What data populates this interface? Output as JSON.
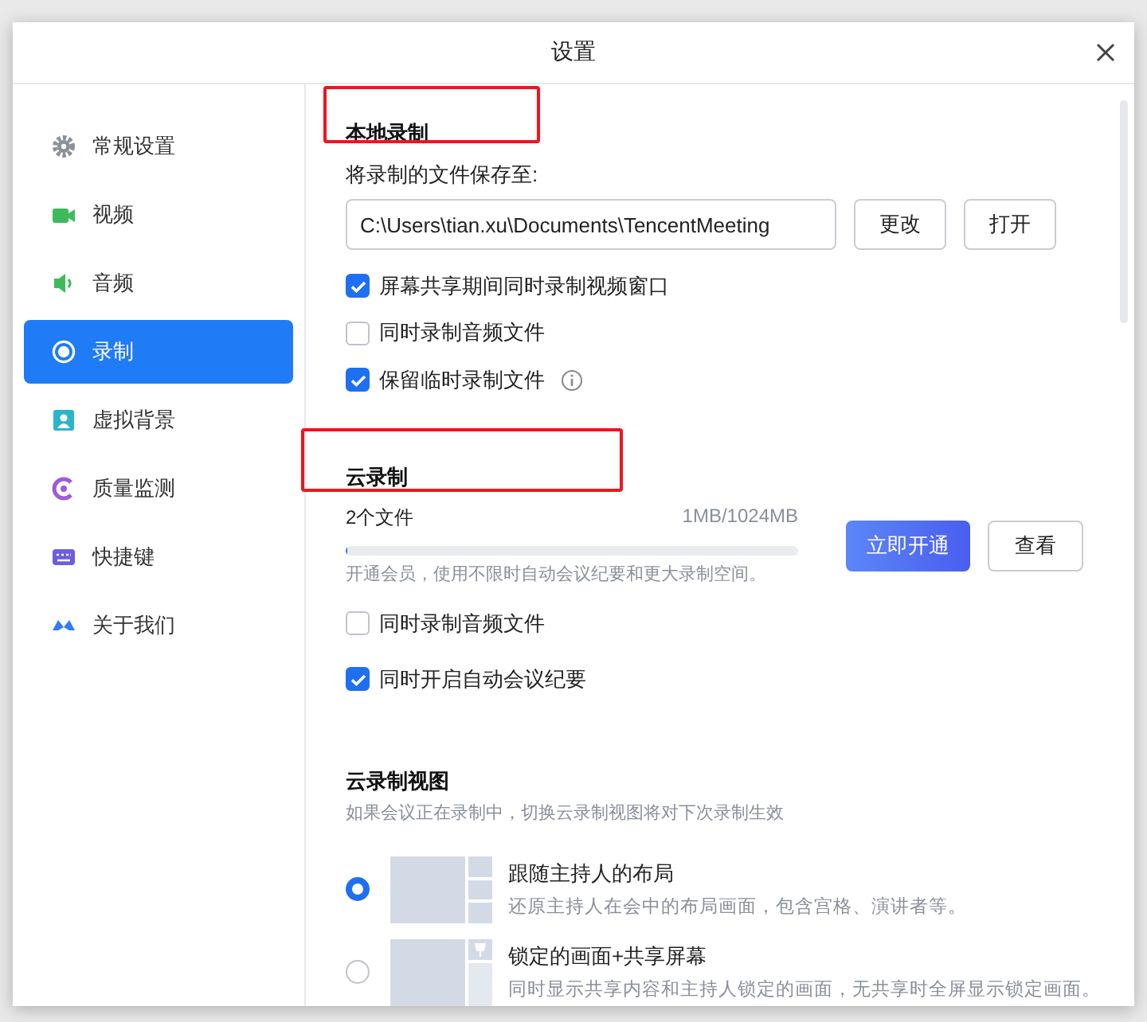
{
  "window": {
    "title": "设置"
  },
  "sidebar": {
    "items": [
      {
        "label": "常规设置",
        "selected": false
      },
      {
        "label": "视频",
        "selected": false
      },
      {
        "label": "音频",
        "selected": false
      },
      {
        "label": "录制",
        "selected": true
      },
      {
        "label": "虚拟背景",
        "selected": false
      },
      {
        "label": "质量监测",
        "selected": false
      },
      {
        "label": "快捷键",
        "selected": false
      },
      {
        "label": "关于我们",
        "selected": false
      }
    ]
  },
  "local_recording": {
    "title": "本地录制",
    "highlighted": true,
    "path_label": "将录制的文件保存至:",
    "path_value": "C:\\Users\\tian.xu\\Documents\\TencentMeeting",
    "buttons": [
      "更改",
      "打开"
    ],
    "options": [
      {
        "label": "屏幕共享期间同时录制视频窗口",
        "checked": true,
        "info": false
      },
      {
        "label": "同时录制音频文件",
        "checked": false,
        "info": false
      },
      {
        "label": "保留临时录制文件",
        "checked": true,
        "info": true
      }
    ]
  },
  "cloud_recording": {
    "title": "云录制",
    "highlighted": true,
    "files": "2个文件",
    "usage": "1MB/1024MB",
    "level": 0.001,
    "hint": "开通会员，使用不限时自动会议纪要和更大录制空间。",
    "buttons": [
      "立即开通",
      "查看"
    ],
    "options": [
      {
        "label": "同时录制音频文件",
        "checked": false
      },
      {
        "label": "同时开启自动会议纪要",
        "checked": true
      }
    ]
  },
  "cloud_view": {
    "title": "云录制视图",
    "hint": "如果会议正在录制中，切换云录制视图将对下次录制生效",
    "options": [
      {
        "title": "跟随主持人的布局",
        "description": "还原主持人在会中的布局画面，包含宫格、演讲者等。",
        "selected": true
      },
      {
        "title": "锁定的画面+共享屏幕",
        "description": "同时显示共享内容和主持人锁定的画面，无共享时全屏显示锁定画面。",
        "selected": false
      }
    ]
  }
}
